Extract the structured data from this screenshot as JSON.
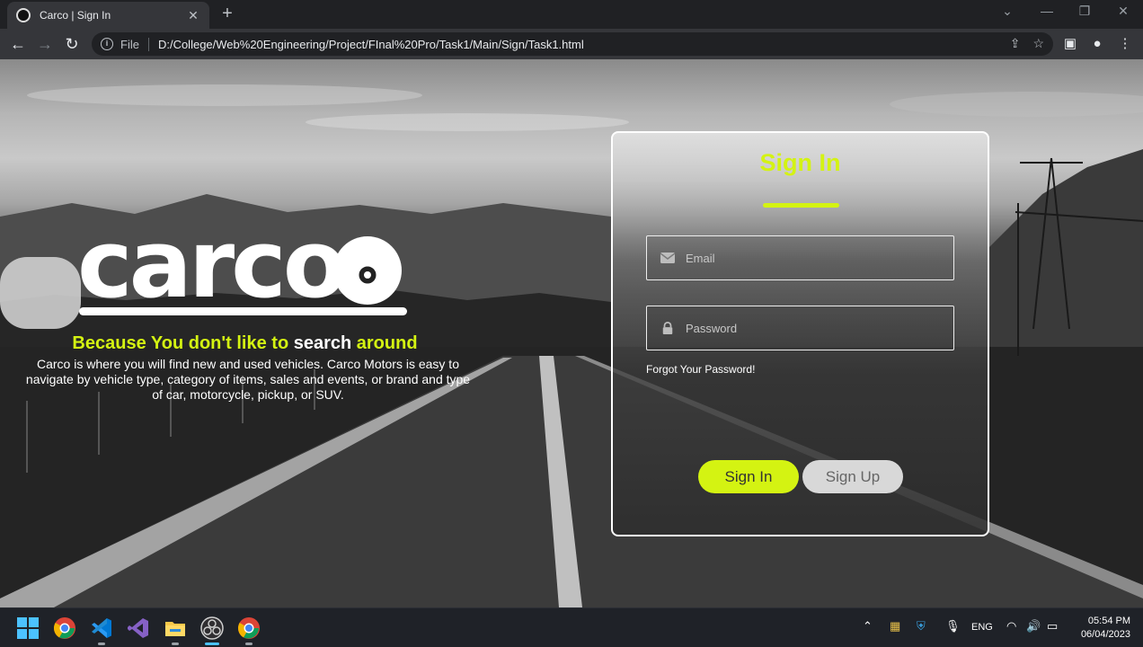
{
  "browser": {
    "tab_title": "Carco | Sign In",
    "omnibox_scheme": "File",
    "url": "D:/College/Web%20Engineering/Project/FInal%20Pro/Task1/Main/Sign/Task1.html"
  },
  "page": {
    "logo_text": "carco",
    "tagline": {
      "part1": "Because You don't like to ",
      "part2": "search",
      "part3": " around"
    },
    "description": "Carco is where you will find new and used vehicles. Carco Motors is easy to navigate by vehicle type, category of items, sales and events, or brand and type of car, motorcycle, pickup, or SUV.",
    "signin_card": {
      "title": "Sign In",
      "email_placeholder": "Email",
      "password_placeholder": "Password",
      "forgot_link": "Forgot Your Password!",
      "signin_button": "Sign In",
      "signup_button": "Sign Up"
    }
  },
  "taskbar": {
    "language": "ENG",
    "time": "05:54 PM",
    "date": "06/04/2023"
  },
  "colors": {
    "accent": "#d4f312",
    "card_border": "#ffffff"
  }
}
